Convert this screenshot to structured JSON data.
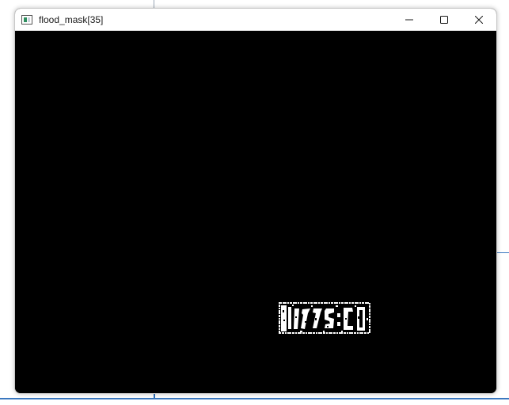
{
  "window": {
    "title": "flood_mask[35]",
    "icon": "opencv-window-icon",
    "controls": {
      "minimize_icon": "minimize-icon",
      "maximize_icon": "maximize-icon",
      "close_icon": "close-icon"
    }
  },
  "canvas": {
    "background": "#000000",
    "foreground": "#ffffff",
    "content": "binary-mask-image"
  },
  "colors": {
    "titlebar_bg": "#ffffff",
    "title_text": "#1a1a1a",
    "taskbar_accent": "#3b78bf"
  }
}
